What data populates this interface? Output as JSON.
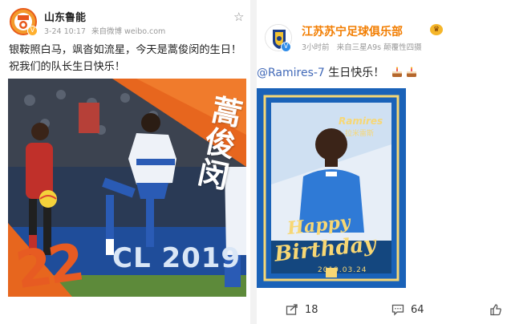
{
  "left_post": {
    "account_name": "山东鲁能",
    "date": "3-24 10:17",
    "source": "来自微博 weibo.com",
    "text": "银鞍照白马，飒沓如流星，今天是蒿俊闵的生日！祝我们的队长生日快乐！",
    "image": {
      "overlay_name": "蒿俊闵",
      "overlay_number": "22",
      "board_text": "CL 2019"
    },
    "icons": {
      "avatar": "shandong-luneng-logo-icon",
      "verified": "verified-badge-icon",
      "star": "star-outline-icon"
    }
  },
  "right_post": {
    "account_name": "江苏苏宁足球俱乐部",
    "time": "3小时前",
    "source": "来自三星A9s 颠覆性四摄",
    "mention": "@Ramires-7",
    "text": " 生日快乐！",
    "image": {
      "player_name": "Ramires",
      "player_name_cn": "拉米雷斯",
      "line1": "Happy",
      "line2": "Birthday",
      "date": "2019.03.24"
    },
    "actions": {
      "reposts": "18",
      "comments": "64"
    },
    "icons": {
      "avatar": "jiangsu-suning-logo-icon",
      "verified": "verified-badge-icon",
      "vip": "crown-icon",
      "cake": "cake-emoji-icon"
    }
  },
  "colors": {
    "orange_accent": "#f27d00",
    "link_blue": "#4169b8",
    "meta_gray": "#999999"
  }
}
